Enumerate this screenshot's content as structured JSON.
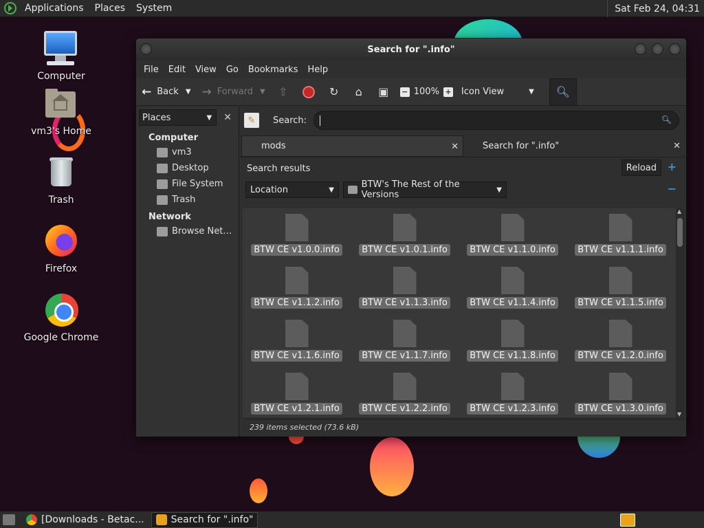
{
  "top_panel": {
    "menus": [
      "Applications",
      "Places",
      "System"
    ],
    "clock": "Sat Feb 24, 04:31"
  },
  "desktop_icons": [
    {
      "label": "Computer",
      "icon": "computer-icon"
    },
    {
      "label": "vm3's Home",
      "icon": "home-folder-icon"
    },
    {
      "label": "Trash",
      "icon": "trash-icon"
    },
    {
      "label": "Firefox",
      "icon": "firefox-icon"
    },
    {
      "label": "Google Chrome",
      "icon": "chrome-icon"
    }
  ],
  "window": {
    "title": "Search for \".info\"",
    "menu": [
      "File",
      "Edit",
      "View",
      "Go",
      "Bookmarks",
      "Help"
    ],
    "toolbar": {
      "back": "Back",
      "forward": "Forward",
      "zoom": "100%",
      "view_mode": "Icon View"
    },
    "sidebar": {
      "selector": "Places",
      "sections": [
        {
          "heading": "Computer",
          "items": [
            "vm3",
            "Desktop",
            "File System",
            "Trash"
          ]
        },
        {
          "heading": "Network",
          "items": [
            "Browse Net…"
          ]
        }
      ]
    },
    "search": {
      "label": "Search:",
      "value": ""
    },
    "tabs": [
      {
        "label": "mods"
      },
      {
        "label": "Search for \".info\""
      }
    ],
    "results": {
      "heading": "Search results",
      "reload": "Reload",
      "criteria": "Location",
      "location": "BTW's The Rest of the Versions"
    },
    "files": [
      "BTW CE v1.0.0.info",
      "BTW CE v1.0.1.info",
      "BTW CE v1.1.0.info",
      "BTW CE v1.1.1.info",
      "BTW CE v1.1.2.info",
      "BTW CE v1.1.3.info",
      "BTW CE v1.1.4.info",
      "BTW CE v1.1.5.info",
      "BTW CE v1.1.6.info",
      "BTW CE v1.1.7.info",
      "BTW CE v1.1.8.info",
      "BTW CE v1.2.0.info",
      "BTW CE v1.2.1.info",
      "BTW CE v1.2.2.info",
      "BTW CE v1.2.3.info",
      "BTW CE v1.3.0.info"
    ],
    "status": "239 items selected (73.6 kB)"
  },
  "bottom_panel": {
    "tasks": [
      "[Downloads - Betac...",
      "Search for \".info\""
    ]
  }
}
